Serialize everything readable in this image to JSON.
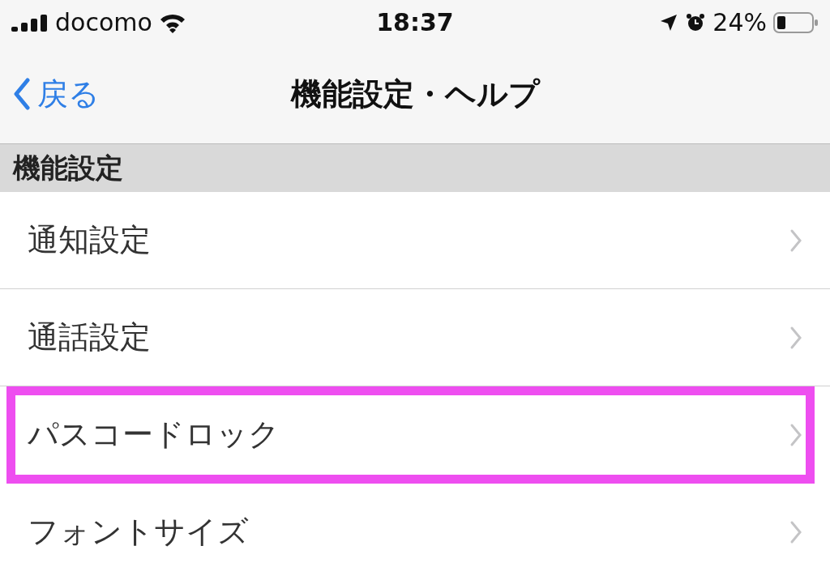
{
  "status_bar": {
    "carrier": "docomo",
    "time": "18:37",
    "battery": "24%"
  },
  "nav": {
    "back": "戻る",
    "title": "機能設定・ヘルプ"
  },
  "section": {
    "title": "機能設定"
  },
  "rows": [
    {
      "label": "通知設定",
      "highlighted": false
    },
    {
      "label": "通話設定",
      "highlighted": false
    },
    {
      "label": "パスコードロック",
      "highlighted": true
    },
    {
      "label": "フォントサイズ",
      "highlighted": false
    }
  ]
}
